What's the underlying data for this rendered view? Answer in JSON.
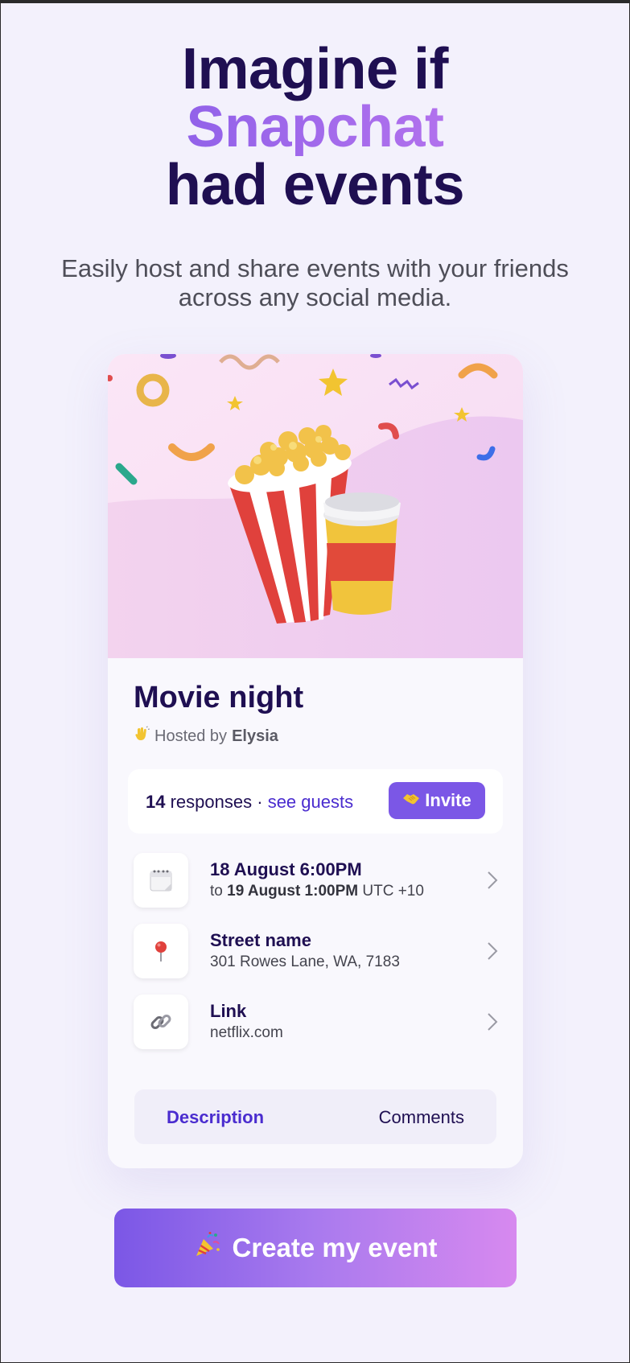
{
  "hero": {
    "line1": "Imagine if",
    "line2": "Snapchat",
    "line3": "had events",
    "subtitle": "Easily host and share events with your friends across any social media."
  },
  "event": {
    "title": "Movie night",
    "host_prefix": "Hosted by",
    "host_name": "Elysia",
    "host_icon": "waving-hand-icon",
    "responses_count": "14",
    "responses_label": "responses ·",
    "see_guests": "see guests",
    "invite_label": "Invite",
    "invite_icon": "handshake-icon"
  },
  "details": [
    {
      "icon": "calendar-icon",
      "main": "18 August 6:00PM",
      "sub_prefix": "to",
      "sub_bold": "19 August 1:00PM",
      "sub_suffix": "UTC +10"
    },
    {
      "icon": "pin-icon",
      "main": "Street name",
      "sub": "301 Rowes Lane, WA, 7183"
    },
    {
      "icon": "link-icon",
      "main": "Link",
      "sub": "netflix.com"
    }
  ],
  "tabs": {
    "description": "Description",
    "comments": "Comments"
  },
  "cta": {
    "label": "Create my event",
    "icon": "party-popper-icon"
  },
  "colors": {
    "brand_dark": "#1f0f52",
    "accent_purple": "#7b57e6",
    "accent_pink": "#d789ef",
    "link": "#4a2ccf",
    "background": "#f3f1fc"
  }
}
